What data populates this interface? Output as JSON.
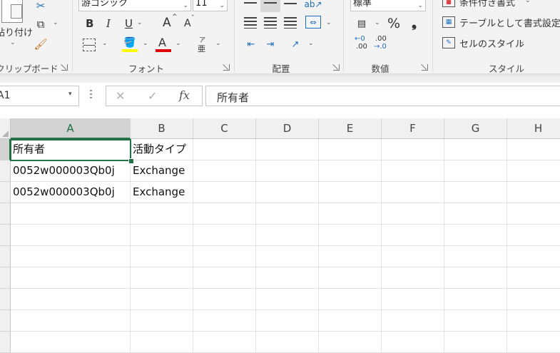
{
  "ribbon": {
    "clipboard": {
      "paste_label": "貼り付け",
      "group_label": "クリップボード"
    },
    "font": {
      "font_name": "游ゴシック",
      "font_size": "11",
      "bold": "B",
      "italic": "I",
      "underline": "U",
      "grow": "A",
      "shrink": "A",
      "color_letter": "A",
      "phonetic": "ア",
      "phonetic_sub": "亜",
      "group_label": "フォント",
      "highlight_color": "#ffff00",
      "font_color": "#e00000"
    },
    "alignment": {
      "group_label": "配置"
    },
    "number": {
      "format": "標準",
      "percent": "%",
      "comma": "❟",
      "inc_top": "←0",
      "inc_bot": ".00",
      "dec_top": ".00",
      "dec_bot": "→.0",
      "group_label": "数値"
    },
    "styles": {
      "conditional": "条件付き書式",
      "table": "テーブルとして書式設定",
      "cell_styles": "セルのスタイル",
      "group_label": "スタイル"
    }
  },
  "formula_bar": {
    "name_box": "A1",
    "cancel": "✕",
    "enter": "✓",
    "fx": "fx",
    "content": "所有者"
  },
  "sheet": {
    "columns": [
      "A",
      "B",
      "C",
      "D",
      "E",
      "F",
      "G",
      "H"
    ],
    "rows": [
      [
        "所有者",
        "活動タイプ",
        "",
        "",
        "",
        "",
        "",
        ""
      ],
      [
        "0052w000003Qb0j",
        "Exchange",
        "",
        "",
        "",
        "",
        "",
        ""
      ],
      [
        "0052w000003Qb0j",
        "Exchange",
        "",
        "",
        "",
        "",
        "",
        ""
      ],
      [
        "",
        "",
        "",
        "",
        "",
        "",
        "",
        ""
      ],
      [
        "",
        "",
        "",
        "",
        "",
        "",
        "",
        ""
      ],
      [
        "",
        "",
        "",
        "",
        "",
        "",
        "",
        ""
      ],
      [
        "",
        "",
        "",
        "",
        "",
        "",
        "",
        ""
      ],
      [
        "",
        "",
        "",
        "",
        "",
        "",
        "",
        ""
      ],
      [
        "",
        "",
        "",
        "",
        "",
        "",
        "",
        ""
      ],
      [
        "",
        "",
        "",
        "",
        "",
        "",
        "",
        ""
      ]
    ],
    "selected_cell": "A1",
    "accent": "#217346"
  }
}
